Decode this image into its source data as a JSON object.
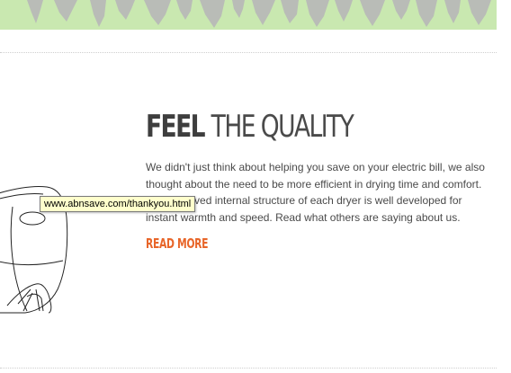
{
  "banner": {
    "color": "#c9e8b0",
    "pattern_color": "#b9b9b9"
  },
  "feature": {
    "heading_bold": "FEEL",
    "heading_light": "THE QUALITY",
    "body": "We didn't just think about helping you save on your electric bill, we also thought about the need to be more efficient in drying time and comfort. The improved internal structure of each dryer is well developed for instant warmth and speed. Read what others are saying about us.",
    "read_more_label": "READ MORE"
  },
  "tooltip": {
    "text": "www.abnsave.com/thankyou.html"
  },
  "colors": {
    "accent": "#e8662a",
    "text": "#4a4a4a",
    "heading": "#3e3e3e",
    "tooltip_bg": "#ffffcc"
  }
}
